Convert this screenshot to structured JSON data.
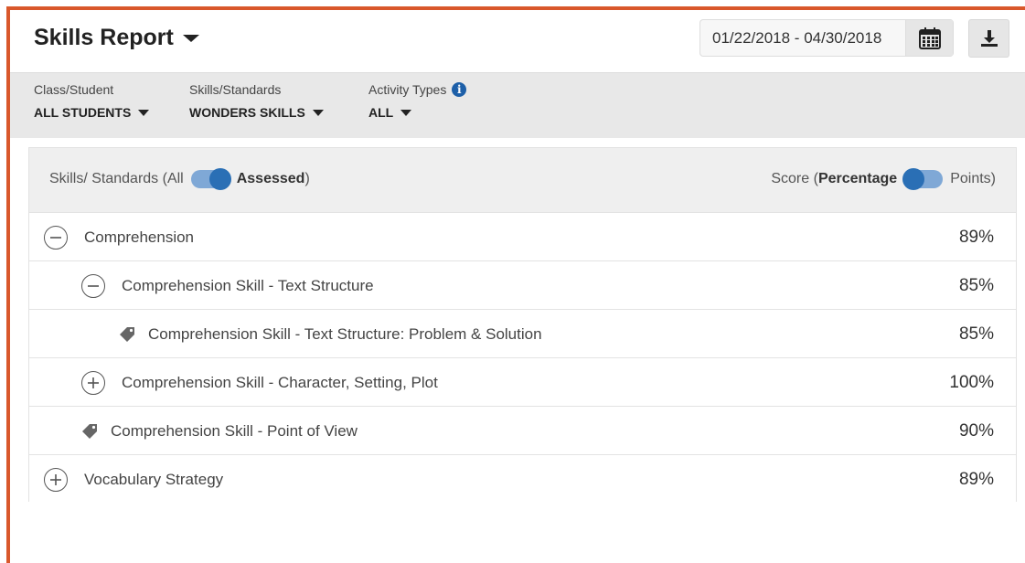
{
  "header": {
    "title": "Skills Report",
    "date_range": "01/22/2018 - 04/30/2018",
    "calendar_icon": "calendar-icon",
    "download_icon": "download-icon"
  },
  "filters": [
    {
      "label": "Class/Student",
      "value": "ALL STUDENTS"
    },
    {
      "label": "Skills/Standards",
      "value": "WONDERS SKILLS"
    },
    {
      "label": "Activity Types",
      "value": "ALL"
    }
  ],
  "panel": {
    "skills_prefix": "Skills/ Standards (All",
    "skills_assessed": "Assessed",
    "skills_suffix": ")",
    "score_prefix": "Score (",
    "score_percentage": "Percentage",
    "score_points": "Points)"
  },
  "rows": [
    {
      "label": "Comprehension",
      "score": "89%",
      "icon": "minus-circle-icon"
    },
    {
      "label": "Comprehension Skill - Text Structure",
      "score": "85%",
      "icon": "minus-circle-icon"
    },
    {
      "label": "Comprehension Skill - Text Structure: Problem & Solution",
      "score": "85%",
      "icon": "tag-icon"
    },
    {
      "label": "Comprehension Skill - Character, Setting, Plot",
      "score": "100%",
      "icon": "plus-circle-icon"
    },
    {
      "label": "Comprehension Skill - Point of View",
      "score": "90%",
      "icon": "tag-icon"
    },
    {
      "label": "Vocabulary Strategy",
      "score": "89%",
      "icon": "plus-circle-icon"
    }
  ],
  "colors": {
    "accent_border": "#d9582b",
    "toggle_blue": "#2a6fb5",
    "info_blue": "#1d5fa8"
  }
}
